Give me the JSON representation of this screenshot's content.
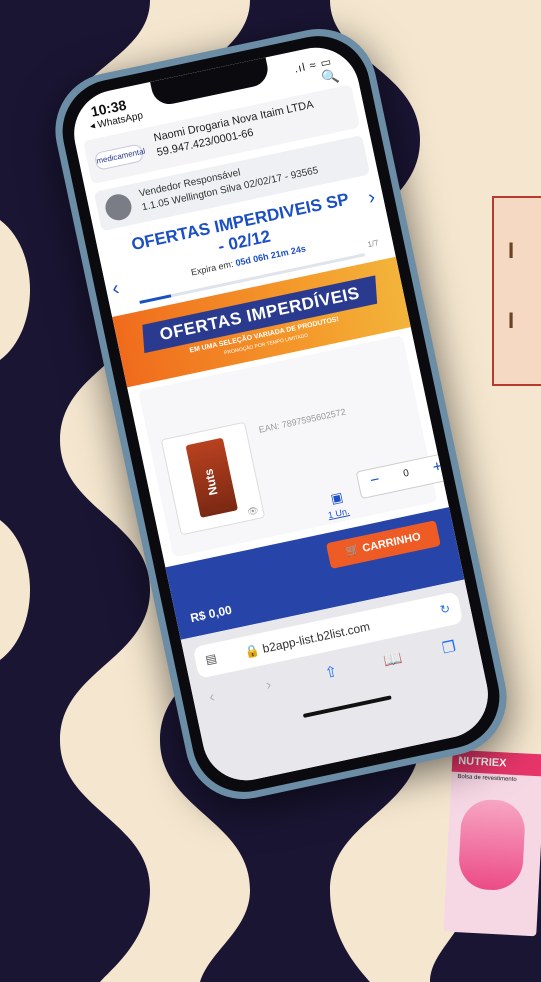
{
  "status_bar": {
    "time": "10:38",
    "back_app": "◂ WhatsApp",
    "icons": ".ıl ≈ ▭"
  },
  "store": {
    "logo": "medicamental",
    "name": "Naomi Drogaria Nova Itaim LTDA",
    "cnpj": "59.947.423/0001-66",
    "search_icon": "search-icon"
  },
  "seller": {
    "title": "Vendedor Responsável",
    "info": "1.1.05 Wellington Silva 02/02/17 - 93565"
  },
  "campaign": {
    "title": "OFERTAS IMPERDIVEIS SP - 02/12",
    "expires_label": "Expira em:",
    "expires_value": "05d 06h 21m 24s",
    "page": "1/7",
    "progress": 0.14
  },
  "banner": {
    "title": "OFERTAS IMPERDÍVEIS",
    "subtitle": "EM UMA SELEÇÃO VARIADA DE PRODUTOS!",
    "caption": "PROMOÇÃO POR TEMPO LIMITADO"
  },
  "product": {
    "pack_label": "Nuts",
    "ean": "EAN: 7897595602572",
    "unit_label": "1 Un.",
    "qty": "0"
  },
  "cart": {
    "button_label": "CARRINHO",
    "total": "R$ 0,00"
  },
  "browser": {
    "url": "b2app-list.b2list.com"
  },
  "side_card": {
    "lines": [
      "I",
      "I"
    ]
  },
  "toy": {
    "brand": "NUTRIEX",
    "sub": "Bolsa de revestimento"
  },
  "colors": {
    "primary": "#1b4fc4",
    "accent": "#ef5b24",
    "cart_bar": "#2744a8",
    "bg": "#1a1533",
    "cream": "#f5e7cf"
  }
}
